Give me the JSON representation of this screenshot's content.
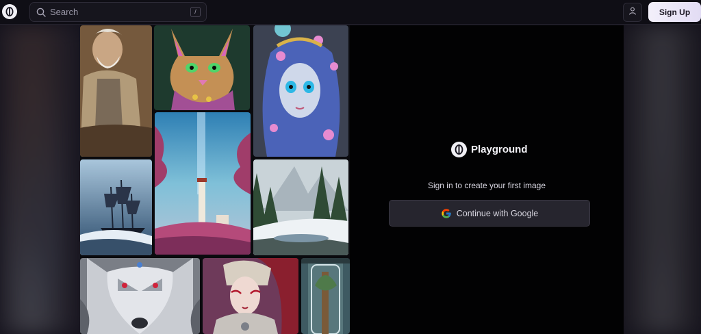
{
  "header": {
    "search_placeholder": "Search",
    "search_shortcut": "/",
    "signup_label": "Sign Up"
  },
  "panel": {
    "brand_name": "Playground",
    "tagline": "Sign in to create your first image",
    "google_button_label": "Continue with Google"
  },
  "gallery": {
    "tiles": [
      {
        "name": "gallery-image-old-man"
      },
      {
        "name": "gallery-image-jeweled-cat"
      },
      {
        "name": "gallery-image-blue-hair-girl"
      },
      {
        "name": "gallery-image-lighthouse"
      },
      {
        "name": "gallery-image-ship"
      },
      {
        "name": "gallery-image-snowy-forest"
      },
      {
        "name": "gallery-image-silver-wolf"
      },
      {
        "name": "gallery-image-robot-woman"
      },
      {
        "name": "gallery-image-glass-tree"
      }
    ]
  },
  "colors": {
    "background": "#14121c",
    "panel": "#020203",
    "button": "#26252e",
    "signup_gradient_start": "#f3f0fb"
  }
}
